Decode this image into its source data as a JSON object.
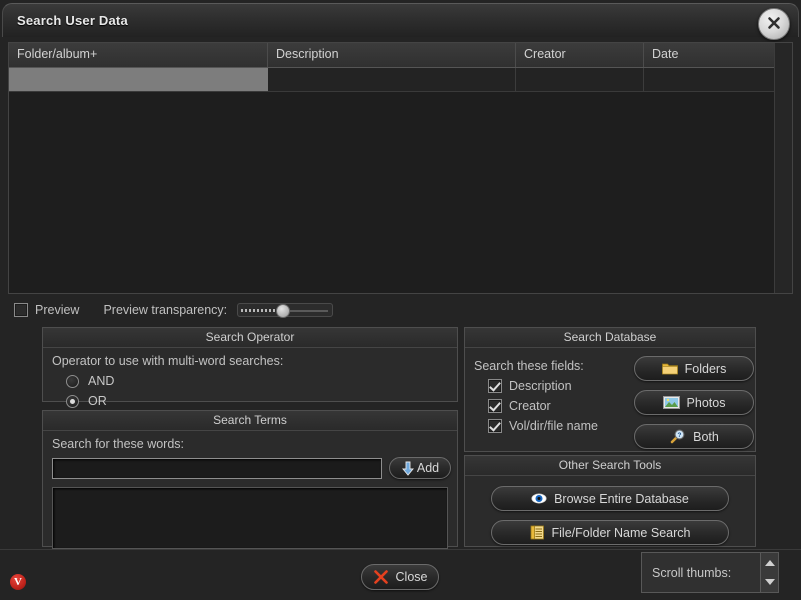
{
  "window": {
    "title": "Search User Data",
    "close_icon": "close-x-icon"
  },
  "results_table": {
    "columns": [
      "Folder/album+",
      "Description",
      "Creator",
      "Date"
    ],
    "rows": [
      {
        "folder": "",
        "description": "",
        "creator": "",
        "date": ""
      }
    ]
  },
  "preview": {
    "checkbox_label": "Preview",
    "checked": false,
    "transparency_label": "Preview transparency:",
    "transparency_value": 45
  },
  "search_operator": {
    "title": "Search Operator",
    "prompt": "Operator to use with multi-word searches:",
    "options": [
      {
        "label": "AND",
        "selected": false
      },
      {
        "label": "OR",
        "selected": true
      }
    ]
  },
  "search_terms": {
    "title": "Search Terms",
    "prompt": "Search for these words:",
    "input_value": "",
    "input_placeholder": "",
    "add_label": "Add",
    "add_icon": "down-arrow-icon",
    "terms": []
  },
  "search_database": {
    "title": "Search Database",
    "fields_label": "Search these fields:",
    "fields": [
      {
        "label": "Description",
        "checked": true
      },
      {
        "label": "Creator",
        "checked": true
      },
      {
        "label": "Vol/dir/file name",
        "checked": true
      }
    ],
    "buttons": [
      {
        "label": "Folders",
        "icon": "folder-icon"
      },
      {
        "label": "Photos",
        "icon": "photo-icon"
      },
      {
        "label": "Both",
        "icon": "magnifier-question-icon"
      }
    ]
  },
  "other_search_tools": {
    "title": "Other Search Tools",
    "buttons": [
      {
        "label": "Browse Entire Database",
        "icon": "eye-icon"
      },
      {
        "label": "File/Folder Name Search",
        "icon": "list-file-icon"
      }
    ]
  },
  "footer": {
    "close_label": "Close",
    "close_icon": "red-x-icon",
    "scroll_thumbs_label": "Scroll thumbs:",
    "spinner_up_icon": "triangle-up-icon",
    "spinner_down_icon": "triangle-down-icon",
    "app_logo_letter": "V"
  },
  "colors": {
    "window_bg": "#242424",
    "panel_bg": "#2b2b2b",
    "accent_red": "#c0241c",
    "selection_gray": "#7d7d7d",
    "text": "#c8c8c8"
  }
}
